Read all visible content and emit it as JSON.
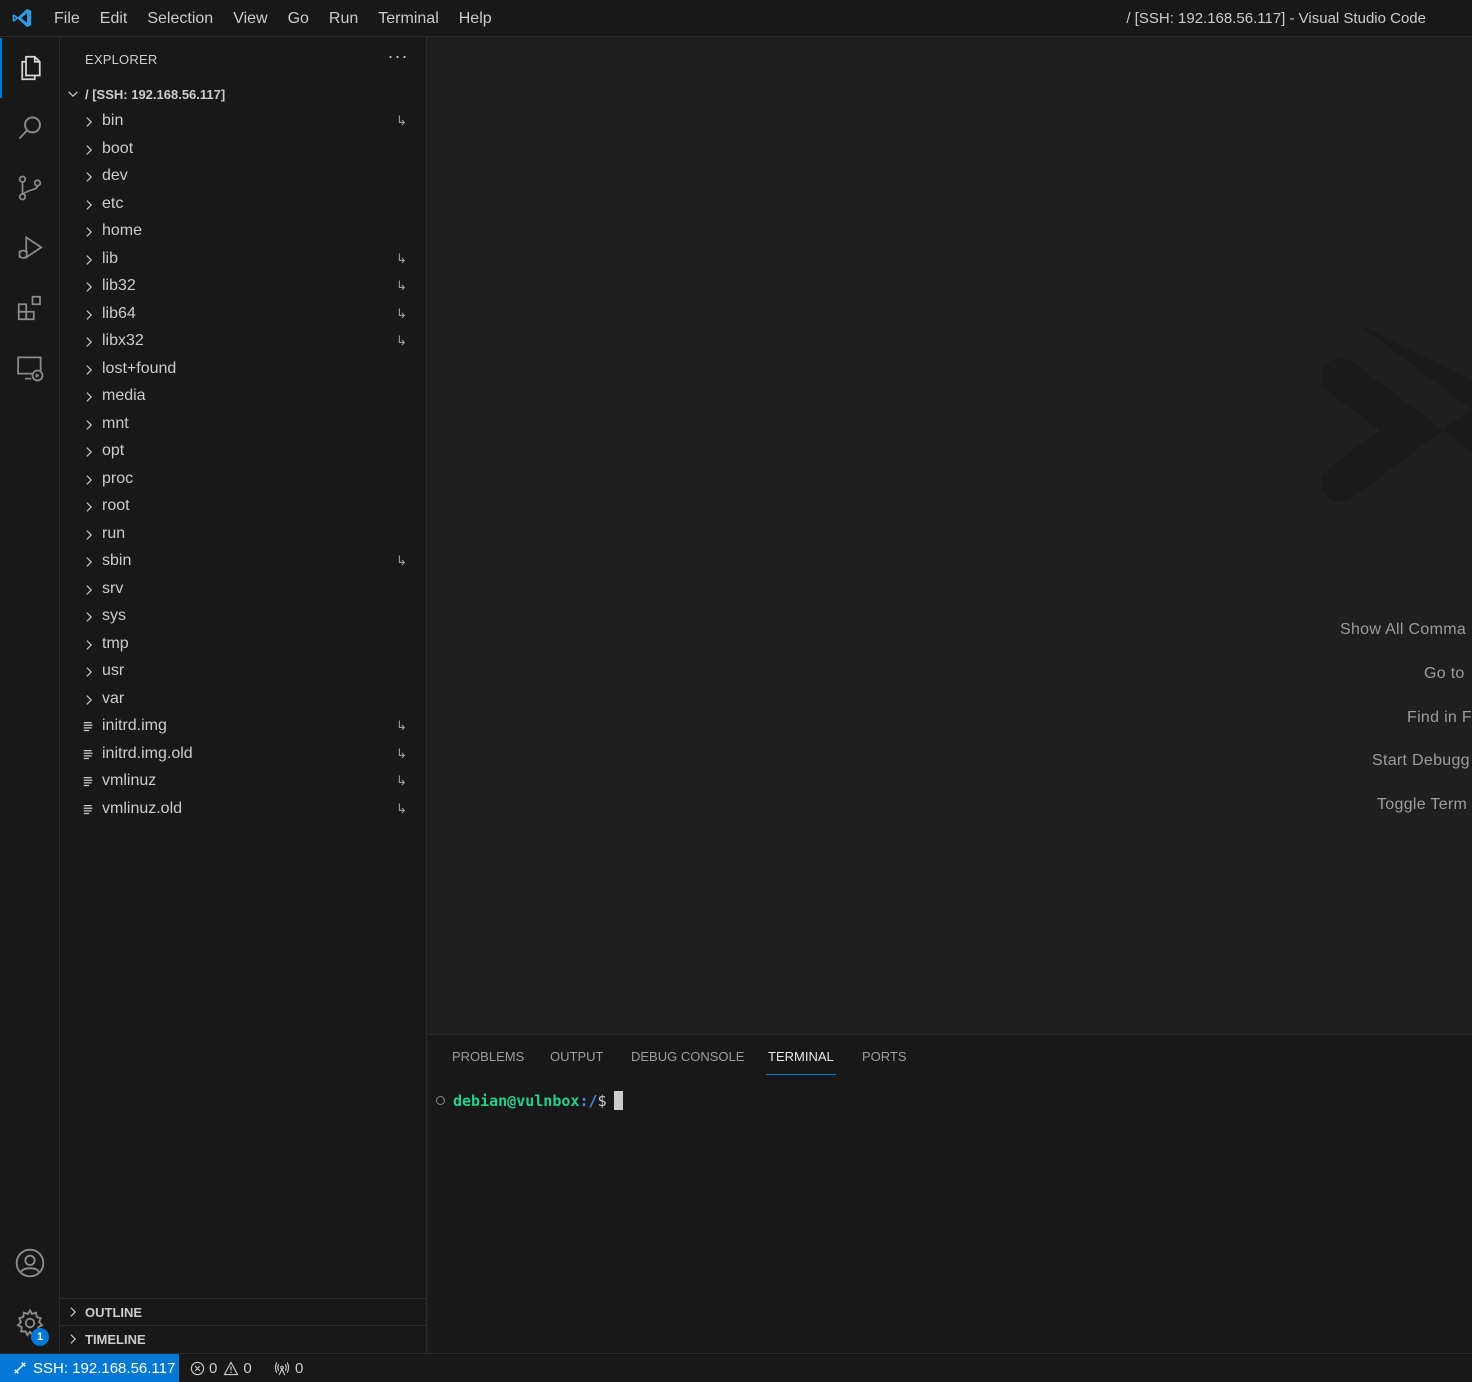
{
  "window": {
    "title": "/ [SSH: 192.168.56.117] - Visual Studio Code"
  },
  "menu": [
    "File",
    "Edit",
    "Selection",
    "View",
    "Go",
    "Run",
    "Terminal",
    "Help"
  ],
  "activity": {
    "accounts_badge": "1"
  },
  "sidebar": {
    "title": "EXPLORER",
    "more_label": "···",
    "root": "/ [SSH: 192.168.56.117]",
    "items": [
      {
        "label": "bin",
        "type": "folder",
        "symlink": true
      },
      {
        "label": "boot",
        "type": "folder",
        "symlink": false
      },
      {
        "label": "dev",
        "type": "folder",
        "symlink": false
      },
      {
        "label": "etc",
        "type": "folder",
        "symlink": false
      },
      {
        "label": "home",
        "type": "folder",
        "symlink": false
      },
      {
        "label": "lib",
        "type": "folder",
        "symlink": true
      },
      {
        "label": "lib32",
        "type": "folder",
        "symlink": true
      },
      {
        "label": "lib64",
        "type": "folder",
        "symlink": true
      },
      {
        "label": "libx32",
        "type": "folder",
        "symlink": true
      },
      {
        "label": "lost+found",
        "type": "folder",
        "symlink": false
      },
      {
        "label": "media",
        "type": "folder",
        "symlink": false
      },
      {
        "label": "mnt",
        "type": "folder",
        "symlink": false
      },
      {
        "label": "opt",
        "type": "folder",
        "symlink": false
      },
      {
        "label": "proc",
        "type": "folder",
        "symlink": false
      },
      {
        "label": "root",
        "type": "folder",
        "symlink": false
      },
      {
        "label": "run",
        "type": "folder",
        "symlink": false
      },
      {
        "label": "sbin",
        "type": "folder",
        "symlink": true
      },
      {
        "label": "srv",
        "type": "folder",
        "symlink": false
      },
      {
        "label": "sys",
        "type": "folder",
        "symlink": false
      },
      {
        "label": "tmp",
        "type": "folder",
        "symlink": false
      },
      {
        "label": "usr",
        "type": "folder",
        "symlink": false
      },
      {
        "label": "var",
        "type": "folder",
        "symlink": false
      },
      {
        "label": "initrd.img",
        "type": "file",
        "symlink": true
      },
      {
        "label": "initrd.img.old",
        "type": "file",
        "symlink": true
      },
      {
        "label": "vmlinuz",
        "type": "file",
        "symlink": true
      },
      {
        "label": "vmlinuz.old",
        "type": "file",
        "symlink": true
      }
    ],
    "symlink_glyph": "↳",
    "sections": {
      "outline": "OUTLINE",
      "timeline": "TIMELINE"
    }
  },
  "editor": {
    "hints": [
      "Show All Comma",
      "Go to",
      "Find in F",
      "Start Debugg",
      "Toggle Term"
    ]
  },
  "panel": {
    "tabs": [
      "PROBLEMS",
      "OUTPUT",
      "DEBUG CONSOLE",
      "TERMINAL",
      "PORTS"
    ],
    "active_tab": "TERMINAL",
    "terminal": {
      "user": "debian@vulnbox",
      "path": ":/",
      "sign": "$"
    }
  },
  "statusbar": {
    "remote": "SSH: 192.168.56.117",
    "errors": "0",
    "warnings": "0",
    "ports": "0"
  },
  "colors": {
    "accent": "#0078d4",
    "terminal_user": "#23d18b",
    "terminal_path": "#3b8eea"
  }
}
